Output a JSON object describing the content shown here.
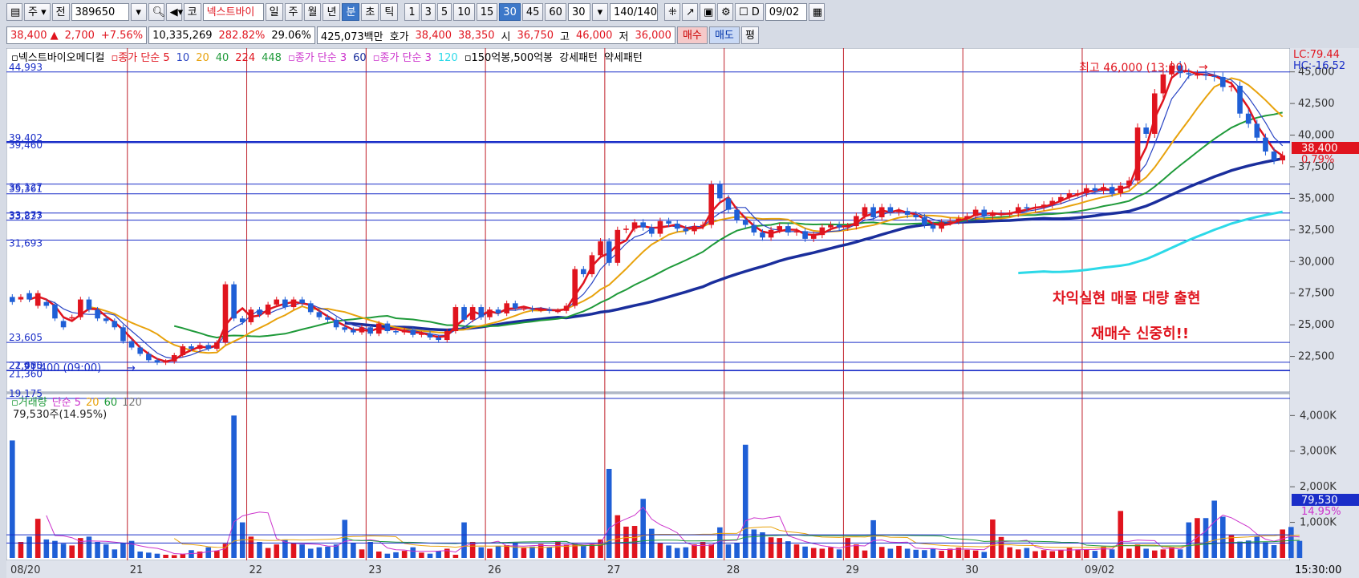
{
  "toolbar": {
    "kind_label": "주",
    "prev_label": "전",
    "code_value": "389650",
    "market_label": "코",
    "name_value": "넥스트바이",
    "period_buttons": [
      "일",
      "주",
      "월",
      "년",
      "분",
      "초",
      "틱"
    ],
    "minute_buttons": [
      "1",
      "3",
      "5",
      "10",
      "15",
      "30",
      "45",
      "60"
    ],
    "minute_value": "30",
    "count_value": "140",
    "count_total": "/140",
    "d_label": "D",
    "date_value": "09/02"
  },
  "quote": {
    "price": "38,400",
    "change_arrow": "▲",
    "change": "2,700",
    "change_pct": "+7.56%",
    "volume": "10,335,269",
    "volume_ratio": "282.82%",
    "turnover_pct": "29.06%",
    "amount": "425,073백만",
    "hoga_label": "호가",
    "ask": "38,400",
    "bid": "38,350",
    "open_label": "시",
    "open": "36,750",
    "high_label": "고",
    "high": "46,000",
    "low_label": "저",
    "low": "36,000",
    "buy_label": "매수",
    "sell_label": "매도",
    "eval_label": "평"
  },
  "colors": {
    "up": "#e0141e",
    "down": "#1f5fd6",
    "ma5": "#e0141e",
    "ma10": "#2a45c4",
    "ma20": "#e8a20c",
    "ma40": "#1f9a3a",
    "ma224": "#1a2e9c",
    "ma448": "#2cd9e8",
    "vline": "#c0202a",
    "hline": "#1a2ec8"
  },
  "legend": {
    "price": [
      {
        "text": "넥스트바이오메디컬",
        "color": "#000000"
      },
      {
        "text": "종가 단순 5",
        "color": "#e0141e"
      },
      {
        "text": "10",
        "color": "#2a45c4"
      },
      {
        "text": "20",
        "color": "#e8a20c"
      },
      {
        "text": "40",
        "color": "#1f9a3a"
      },
      {
        "text": "224",
        "color": "#e0141e"
      },
      {
        "text": "448",
        "color": "#1f9a3a"
      },
      {
        "text": "종가 단순 3",
        "color": "#cc33cc"
      },
      {
        "text": "60",
        "color": "#1a2e9c"
      },
      {
        "text": "종가 단순 3",
        "color": "#cc33cc"
      },
      {
        "text": "120",
        "color": "#2cd9e8"
      },
      {
        "text": "150억봉,500억봉",
        "color": "#000000"
      },
      {
        "text": "강세패턴",
        "color": "#000000"
      },
      {
        "text": "약세패턴",
        "color": "#000000"
      }
    ],
    "volume": [
      {
        "text": "거래량",
        "color": "#1f9a3a"
      },
      {
        "text": "단순 5",
        "color": "#cc33cc"
      },
      {
        "text": "20",
        "color": "#e8a20c"
      },
      {
        "text": "60",
        "color": "#1f9a3a"
      },
      {
        "text": "120",
        "color": "#777777"
      }
    ],
    "volume_value": "79,530주(14.95%)"
  },
  "annotations": {
    "high_note": "최고 46,000 (13:00)",
    "low_note": "21,400 (09:00)",
    "note1": "차익실현 매물 대량 출현",
    "note2": "재매수 신중히!!",
    "lc": "LC:79.44",
    "hc": "HC:-16.52",
    "last_price": "38,400",
    "last_pct": "0.79%",
    "vol_last": "79,530",
    "vol_pct": "14.95%",
    "time": "15:30:00"
  },
  "chart_data": {
    "type": "candlestick",
    "title": "넥스트바이오메디컬",
    "x_axis_labels": [
      "08/20",
      "21",
      "22",
      "23",
      "26",
      "27",
      "28",
      "29",
      "30",
      "09/02"
    ],
    "y_axis": {
      "ylim": [
        20000,
        46500
      ],
      "ticks": [
        22500,
        25000,
        27500,
        30000,
        32500,
        35000,
        37500,
        40000,
        42500,
        45000
      ],
      "tick_labels": [
        "22,500",
        "25,000",
        "27,500",
        "30,000",
        "32,500",
        "35,000",
        "37,500",
        "40,000",
        "42,500",
        "45,000"
      ]
    },
    "horizontal_levels": [
      {
        "value": 44993,
        "label": "44,993"
      },
      {
        "value": 39460,
        "label": "39,460"
      },
      {
        "value": 39402,
        "label": "39,402"
      },
      {
        "value": 36127,
        "label": "36,127"
      },
      {
        "value": 35361,
        "label": "35,361"
      },
      {
        "value": 33837,
        "label": "33,837"
      },
      {
        "value": 33273,
        "label": "33,273"
      },
      {
        "value": 31693,
        "label": "31,693"
      },
      {
        "value": 23605,
        "label": "23,605"
      },
      {
        "value": 22035,
        "label": "22,035"
      },
      {
        "value": 21400,
        "label": "21,400"
      },
      {
        "value": 21360,
        "label": "21,360"
      },
      {
        "value": 19175,
        "label": "19,175"
      }
    ],
    "close": [
      26800,
      27200,
      27000,
      27500,
      26500,
      25500,
      24800,
      25600,
      27000,
      26200,
      25500,
      25300,
      24800,
      23700,
      23200,
      22700,
      22200,
      22000,
      22100,
      22600,
      23300,
      23100,
      23400,
      23100,
      23600,
      28200,
      25500,
      25200,
      26200,
      25800,
      26600,
      27000,
      26400,
      27000,
      26700,
      26000,
      25600,
      25400,
      24800,
      24600,
      24400,
      24800,
      24300,
      25100,
      24500,
      24400,
      24600,
      24200,
      24300,
      24000,
      23800,
      24500,
      26400,
      25400,
      26400,
      25600,
      26200,
      25900,
      26700,
      26300,
      26300,
      26200,
      26200,
      26100,
      26100,
      26500,
      29400,
      29000,
      30500,
      31600,
      29900,
      32500,
      32600,
      33100,
      32700,
      32200,
      33200,
      33000,
      32600,
      32400,
      32800,
      32900,
      36100,
      35000,
      34100,
      33300,
      32900,
      32300,
      31900,
      32500,
      32800,
      32300,
      32400,
      31800,
      32100,
      32700,
      32900,
      32700,
      32800,
      33600,
      34300,
      33500,
      34300,
      33900,
      34000,
      33700,
      33500,
      32900,
      32600,
      33100,
      33200,
      33400,
      33600,
      34100,
      33600,
      33800,
      33800,
      33800,
      34300,
      34200,
      34300,
      34500,
      34800,
      35100,
      35400,
      35400,
      35800,
      35600,
      35900,
      35400,
      36000,
      36400,
      40600,
      40100,
      43300,
      44800,
      45500,
      44900,
      44800,
      44800,
      44700,
      44600,
      43800,
      43900,
      41700,
      40900,
      39800,
      38700,
      38000,
      38400
    ],
    "open": [
      27200,
      27000,
      27500,
      26500,
      26800,
      26600,
      25300,
      25500,
      25600,
      27000,
      26200,
      25500,
      25300,
      24800,
      23700,
      23200,
      22700,
      22200,
      22000,
      22100,
      22600,
      23300,
      23100,
      23400,
      23100,
      23600,
      28200,
      25500,
      25200,
      26200,
      25800,
      26600,
      27000,
      26400,
      27000,
      26700,
      26000,
      25600,
      25400,
      24800,
      24600,
      24400,
      24800,
      24300,
      25100,
      24500,
      24400,
      24600,
      24200,
      24300,
      24000,
      23800,
      24500,
      26400,
      25400,
      26400,
      25600,
      26200,
      25900,
      26700,
      26300,
      26300,
      26200,
      26200,
      26100,
      26100,
      26500,
      29400,
      29000,
      30500,
      31600,
      29900,
      32500,
      32600,
      33100,
      32700,
      32200,
      33200,
      33000,
      32600,
      32400,
      32800,
      32900,
      36100,
      35000,
      34100,
      33300,
      32900,
      32300,
      31900,
      32500,
      32800,
      32300,
      32400,
      31800,
      32100,
      32700,
      32900,
      32700,
      32800,
      33600,
      34300,
      33500,
      34300,
      33900,
      34000,
      33700,
      33500,
      32900,
      32600,
      33100,
      33200,
      33400,
      33600,
      34100,
      33600,
      33800,
      33800,
      33800,
      34300,
      34200,
      34300,
      34500,
      34800,
      35100,
      35400,
      35400,
      35800,
      35600,
      35900,
      35400,
      36000,
      36400,
      40600,
      40100,
      43300,
      44800,
      45500,
      44900,
      44800,
      44800,
      44700,
      44600,
      43800,
      43900,
      41700,
      40900,
      39800,
      38700,
      38000
    ],
    "volume_k": [
      3300,
      450,
      600,
      1100,
      520,
      480,
      400,
      350,
      560,
      600,
      450,
      380,
      240,
      420,
      480,
      180,
      150,
      120,
      90,
      80,
      110,
      220,
      180,
      300,
      200,
      400,
      4000,
      1000,
      600,
      450,
      280,
      380,
      520,
      420,
      380,
      260,
      300,
      320,
      380,
      1070,
      420,
      240,
      450,
      180,
      120,
      160,
      200,
      300,
      150,
      120,
      200,
      260,
      90,
      1000,
      450,
      300,
      260,
      340,
      360,
      430,
      280,
      320,
      390,
      300,
      450,
      380,
      400,
      360,
      380,
      520,
      2500,
      1200,
      880,
      900,
      1660,
      820,
      420,
      350,
      280,
      300,
      380,
      450,
      380,
      860,
      380,
      420,
      3180,
      800,
      720,
      580,
      560,
      470,
      380,
      320,
      280,
      260,
      300,
      240,
      560,
      380,
      210,
      1060,
      310,
      260,
      340,
      260,
      230,
      220,
      270,
      200,
      260,
      290,
      230,
      210,
      170,
      1080,
      590,
      300,
      240,
      280,
      190,
      220,
      190,
      230,
      280,
      240,
      240,
      200,
      320,
      240,
      1320,
      260,
      380,
      260,
      210,
      240,
      300,
      240,
      1000,
      1120,
      1120,
      1610,
      1160,
      640,
      460,
      490,
      600,
      440,
      360,
      800,
      870,
      480
    ]
  }
}
